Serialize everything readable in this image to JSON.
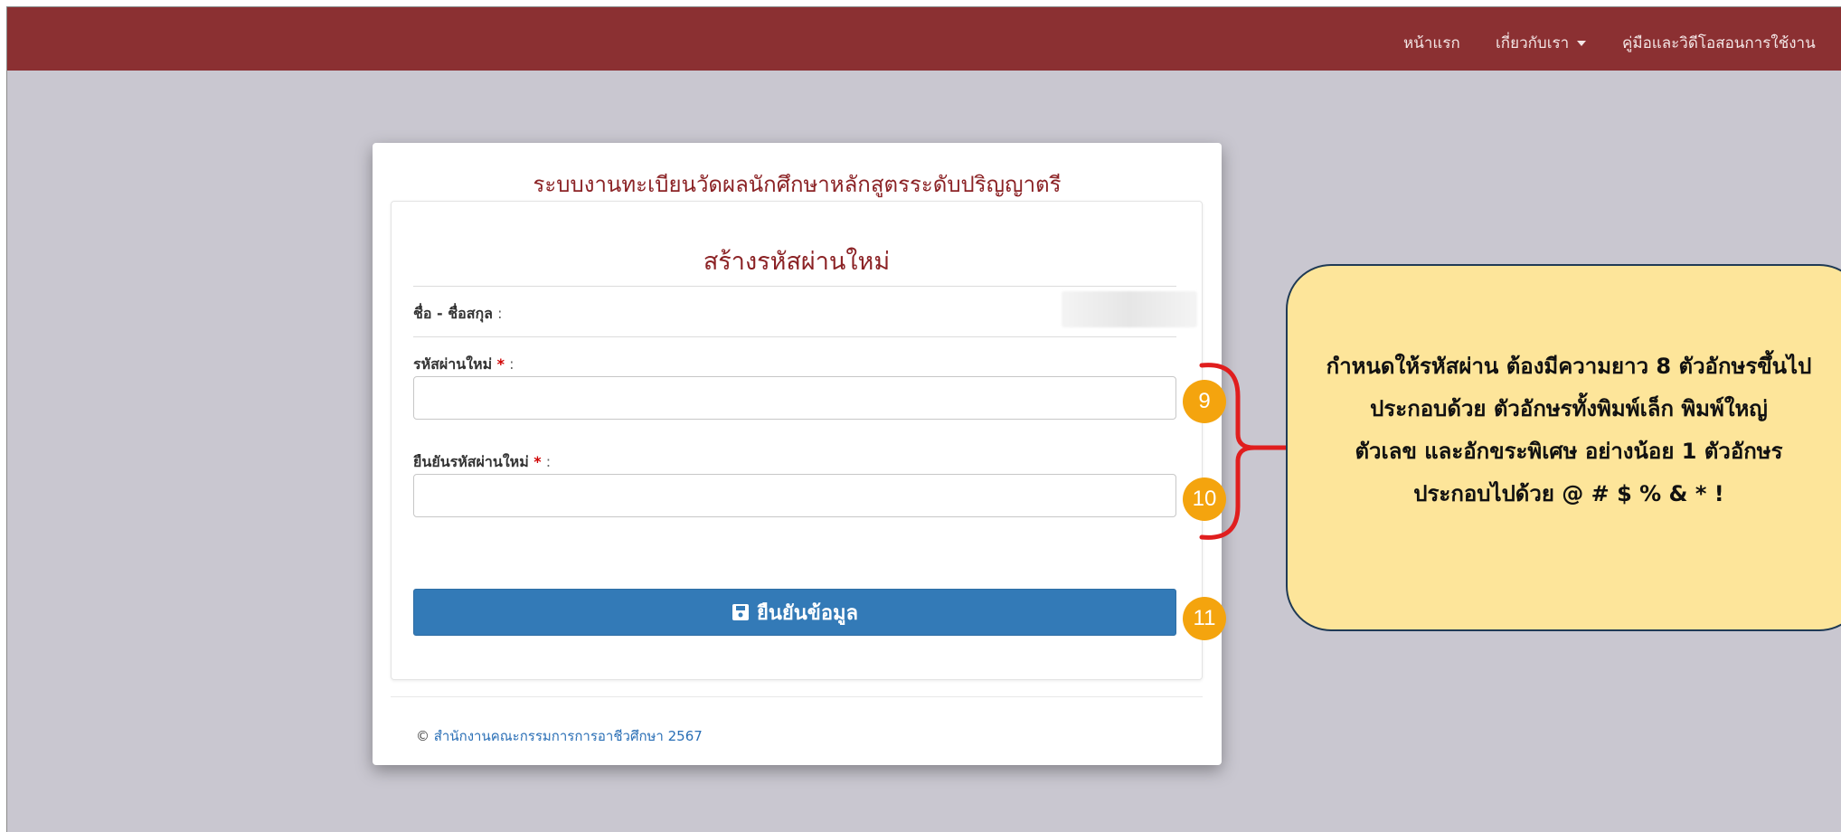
{
  "navbar": {
    "home": "หน้าแรก",
    "about": "เกี่ยวกับเรา",
    "manual": "คู่มือและวิดีโอสอนการใช้งาน"
  },
  "card": {
    "system_title": "ระบบงานทะเบียนวัดผลนักศึกษาหลักสูตรระดับปริญญาตรี",
    "form_title": "สร้างรหัสผ่านใหม่",
    "name_label": "ชื่อ - ชื่อสกุล",
    "colon": " :",
    "required": " *",
    "new_password_label": "รหัสผ่านใหม่",
    "new_password_value": "",
    "confirm_password_label": "ยืนยันรหัสผ่านใหม่",
    "confirm_password_value": "",
    "submit_label": "ยืนยันข้อมูล",
    "copyright_symbol": "© ",
    "copyright_org": "สำนักงานคณะกรรมการการอาชีวศึกษา 2567"
  },
  "annotations": {
    "badges": [
      "9",
      "10",
      "11"
    ],
    "note_lines": [
      "กำหนดให้รหัสผ่าน ต้องมีความยาว 8 ตัวอักษรขึ้นไป",
      "ประกอบด้วย ตัวอักษรทั้งพิมพ์เล็ก พิมพ์ใหญ่",
      "ตัวเลข และอักขระพิเศษ อย่างน้อย 1 ตัวอักษร",
      "ประกอบไปด้วย @ # $ % & * !"
    ],
    "badge_color": "#f4a40e",
    "brace_color": "#e01e1e",
    "note_bg": "#fde59a"
  },
  "colors": {
    "navbar_bg": "#8b3032",
    "title_color": "#8b2225",
    "button_bg": "#337ab7",
    "page_bg": "#c9c7d0"
  }
}
